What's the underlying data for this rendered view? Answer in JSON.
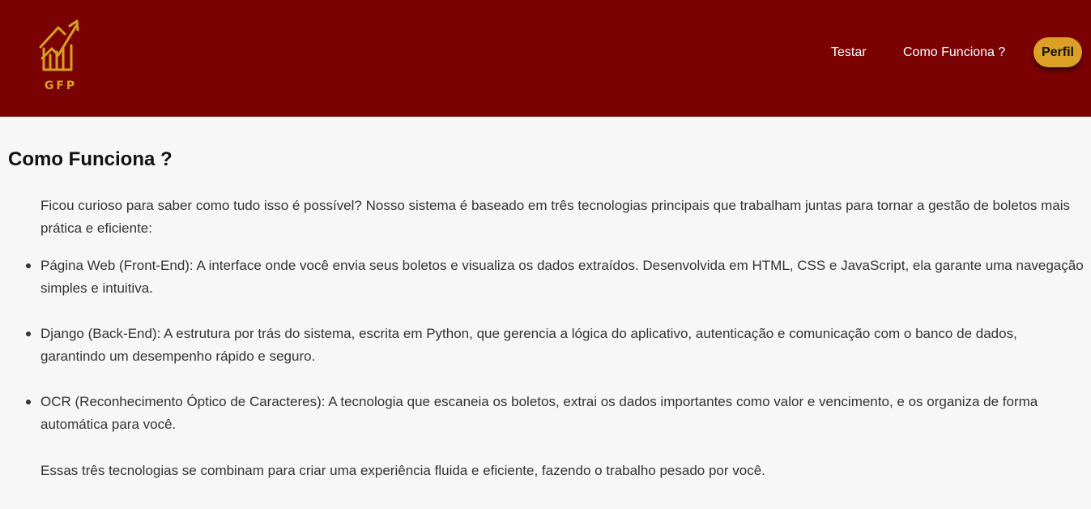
{
  "header": {
    "background_color": "#7b0202",
    "logo": {
      "icon": "rising-chart-house-icon",
      "text": "GFP",
      "color": "#d6a022"
    },
    "nav": {
      "testar_label": "Testar",
      "como_funciona_label": "Como Funciona ?",
      "perfil_label": "Perfil",
      "perfil_color": "#dba024"
    }
  },
  "main": {
    "title": "Como Funciona ?",
    "intro": "Ficou curioso para saber como tudo isso é possível? Nosso sistema é baseado em três tecnologias principais que trabalham juntas para tornar a gestão de boletos mais prática e eficiente:",
    "items": [
      "Página Web (Front-End): A interface onde você envia seus boletos e visualiza os dados extraídos. Desenvolvida em HTML, CSS e JavaScript, ela garante uma navegação simples e intuitiva.",
      "Django (Back-End): A estrutura por trás do sistema, escrita em Python, que gerencia a lógica do aplicativo, autenticação e comunicação com o banco de dados, garantindo um desempenho rápido e seguro.",
      "OCR (Reconhecimento Óptico de Caracteres): A tecnologia que escaneia os boletos, extrai os dados importantes como valor e vencimento, e os organiza de forma automática para você."
    ],
    "outro": "Essas três tecnologias se combinam para criar uma experiência fluida e eficiente, fazendo o trabalho pesado por você."
  }
}
